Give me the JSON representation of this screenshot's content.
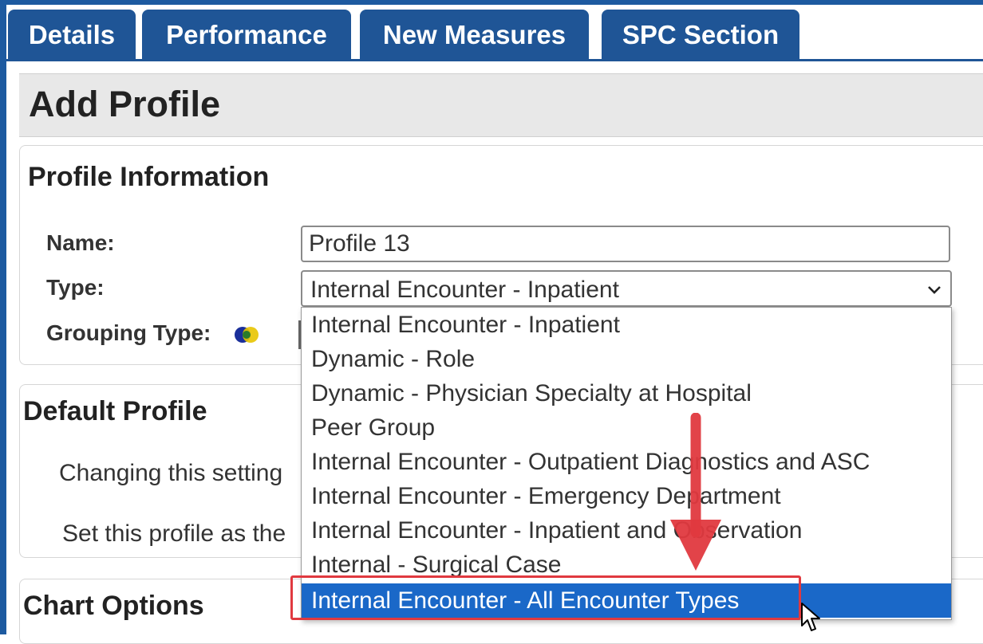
{
  "tabs": [
    {
      "label": "Details"
    },
    {
      "label": "Performance"
    },
    {
      "label": "New Measures"
    },
    {
      "label": "SPC Section"
    }
  ],
  "page_title": "Add Profile",
  "profile_info": {
    "title": "Profile Information",
    "name_label": "Name:",
    "name_value": "Profile 13",
    "type_label": "Type:",
    "type_value": "Internal Encounter - Inpatient",
    "grouping_label": "Grouping Type:"
  },
  "default_profile": {
    "title": "Default Profile",
    "line1": "Changing this setting",
    "line2": "Set this profile as the"
  },
  "chart_options": {
    "title": "Chart Options"
  },
  "type_dropdown": {
    "options": [
      "Internal Encounter - Inpatient",
      "Dynamic - Role",
      "Dynamic - Physician Specialty at Hospital",
      "Peer Group",
      "Internal Encounter - Outpatient Diagnostics and ASC",
      "Internal Encounter - Emergency Department",
      "Internal Encounter - Inpatient and Observation",
      "Internal - Surgical Case",
      "Internal Encounter - All Encounter Types"
    ],
    "selected_index": 8
  },
  "colors": {
    "tab_blue": "#1f5596",
    "selected_blue": "#1a68c8",
    "annotation_red": "#e0393f"
  }
}
